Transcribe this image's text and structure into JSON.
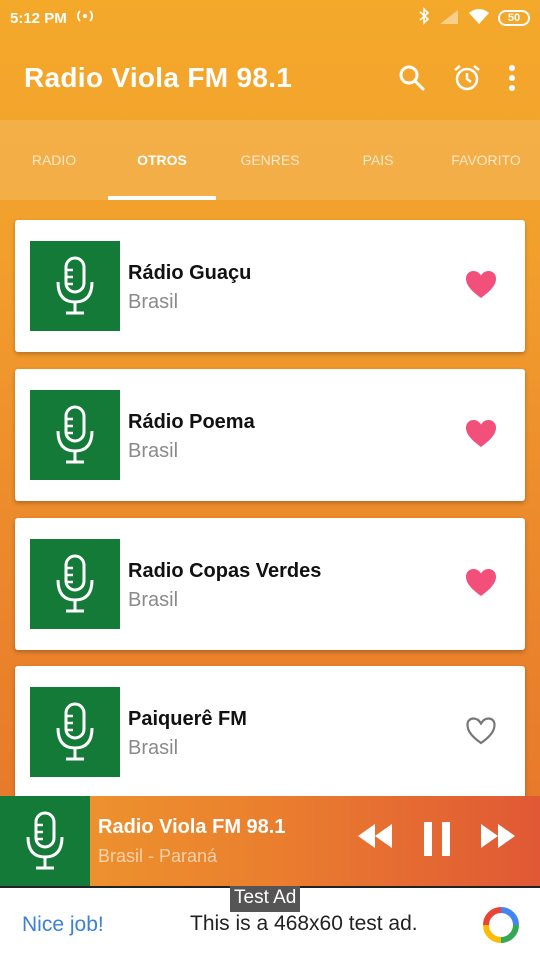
{
  "status_bar": {
    "time": "5:12 PM",
    "battery": "50"
  },
  "app_bar": {
    "title": "Radio Viola FM 98.1",
    "icons": [
      "search-icon",
      "alarm-icon",
      "more-vert-icon"
    ]
  },
  "tabs": [
    {
      "label": "RADIO",
      "active": false
    },
    {
      "label": "OTROS",
      "active": true
    },
    {
      "label": "GENRES",
      "active": false
    },
    {
      "label": "PAIS",
      "active": false
    },
    {
      "label": "FAVORITO",
      "active": false
    }
  ],
  "stations": [
    {
      "name": "Rádio Guaçu",
      "country": "Brasil",
      "favorite": true
    },
    {
      "name": "Rádio Poema",
      "country": "Brasil",
      "favorite": true
    },
    {
      "name": "Radio Copas Verdes",
      "country": "Brasil",
      "favorite": true
    },
    {
      "name": "Paiquerê FM",
      "country": "Brasil",
      "favorite": false
    }
  ],
  "player": {
    "title": "Radio Viola FM 98.1",
    "subtitle": "Brasil - Paraná"
  },
  "ad": {
    "label": "Test Ad",
    "cta": "Nice job!",
    "text": "This is a 468x60 test ad."
  },
  "colors": {
    "accent_orange": "#f2a02c",
    "thumb_green": "#137a37",
    "heart_pink": "#f2507b"
  }
}
